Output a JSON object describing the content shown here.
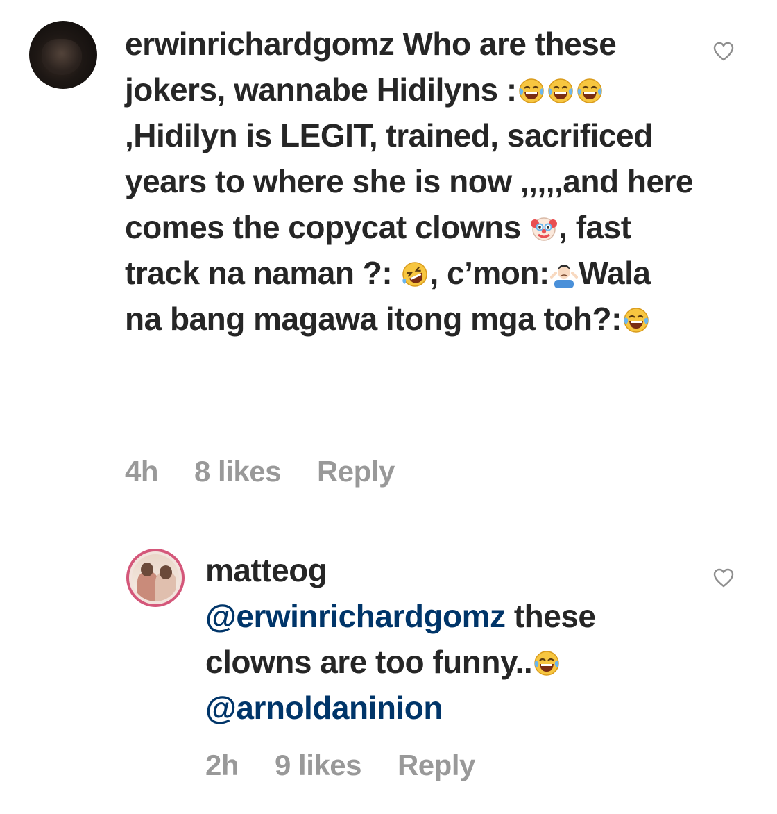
{
  "comments": [
    {
      "username": "erwinrichardgomz",
      "segments": {
        "s1": " Who are these jokers, wannabe Hidilyns :",
        "s2": ",Hidilyn is LEGIT, trained, sacrificed years to where she is now ,,,,,and here comes the copycat clowns ",
        "s3": ", fast track na naman ?: ",
        "s4": ", c’mon:",
        "s5": "Wala na bang magawa itong mga toh?:"
      },
      "emojis": [
        "tears-of-joy",
        "tears-of-joy",
        "tears-of-joy",
        "clown",
        "rofl",
        "person-shrugging",
        "tears-of-joy"
      ],
      "time": "4h",
      "likes": "8 likes",
      "reply_label": "Reply"
    },
    {
      "username": "matteog",
      "mention_1": "@erwinrichardgomz",
      "segments": {
        "s1": " these clowns are too funny..",
        "s2": " "
      },
      "mention_2": "@arnoldaninion",
      "emojis": [
        "tears-of-joy"
      ],
      "time": "2h",
      "likes": "9 likes",
      "reply_label": "Reply"
    }
  ],
  "icons": {
    "like": "heart-outline-icon"
  },
  "colors": {
    "text": "#262626",
    "meta": "#999999",
    "mention": "#003569",
    "avatar_ring": "#d4577a"
  }
}
